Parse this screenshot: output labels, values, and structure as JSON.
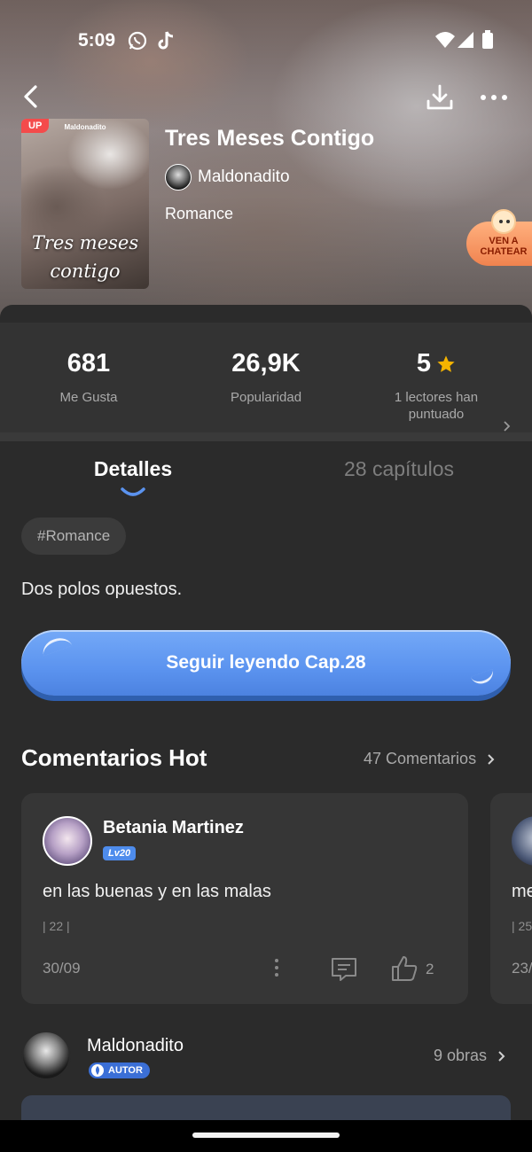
{
  "status_bar": {
    "time": "5:09",
    "icons": [
      "whatsapp-icon",
      "tiktok-icon",
      "wifi-icon",
      "signal-icon",
      "battery-icon"
    ]
  },
  "header": {
    "back_icon": "back-arrow-icon",
    "download_icon": "download-icon",
    "more_icon": "more-dots-icon"
  },
  "book": {
    "cover_badge": "UP",
    "cover_author": "Maldonadito",
    "cover_title": "Tres meses contigo",
    "title": "Tres Meses Contigo",
    "author": "Maldonadito",
    "genre": "Romance"
  },
  "chat_bubble": {
    "text": "VEN A CHATEAR"
  },
  "stats": [
    {
      "value": "681",
      "label": "Me Gusta"
    },
    {
      "value": "26,9K",
      "label": "Popularidad"
    },
    {
      "value": "5",
      "label": "1 lectores han puntuado"
    }
  ],
  "tabs": {
    "details": "Detalles",
    "chapters": "28 capítulos"
  },
  "tag": "#Romance",
  "synopsis": "Dos polos opuestos.",
  "cta": {
    "label": "Seguir leyendo Cap.28"
  },
  "comments_section": {
    "title": "Comentarios Hot",
    "count_link": "47 Comentarios"
  },
  "comments": [
    {
      "user": "Betania Martinez",
      "level": "Lv20",
      "text": "en las buenas y en las malas",
      "chapter": "| 22 |",
      "date": "30/09",
      "likes": "2"
    },
    {
      "text": "me",
      "chapter": "| 25",
      "date": "23/"
    }
  ],
  "author_section": {
    "name": "Maldonadito",
    "badge": "AUTOR",
    "works": "9 obras"
  },
  "colors": {
    "accent": "#5b93ef",
    "panel": "#2b2b2b",
    "card": "#363636",
    "star": "#f5b400",
    "up_badge": "#f44b4b"
  }
}
